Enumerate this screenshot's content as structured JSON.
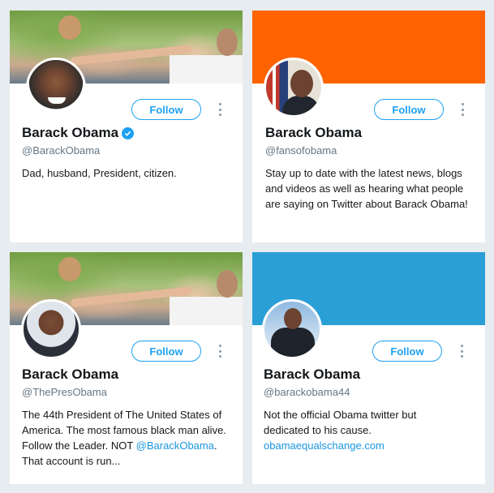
{
  "cards": [
    {
      "name": "Barack Obama",
      "handle": "@BarackObama",
      "follow_label": "Follow",
      "bio": "Dad, husband, President, citizen.",
      "banner": "photo",
      "verified": true
    },
    {
      "name": "Barack Obama",
      "handle": "@fansofobama",
      "follow_label": "Follow",
      "bio": "Stay up to date with the latest news, blogs and videos as well as hearing what people are saying on Twitter about Barack Obama!",
      "banner_color": "#ff6300"
    },
    {
      "name": "Barack Obama",
      "handle": "@ThePresObama",
      "follow_label": "Follow",
      "bio_text": "The 44th President of The United States of America. The most famous black man alive. Follow the Leader. NOT ",
      "bio_link": "@BarackObama",
      "bio_tail": ". That account is run...",
      "banner": "photo"
    },
    {
      "name": "Barack Obama",
      "handle": "@barackobama44",
      "follow_label": "Follow",
      "bio": "Not the official Obama twitter but dedicated to his cause.",
      "link": "obamaequalschange.com",
      "banner_color": "#2a9fd6"
    }
  ],
  "icons": {
    "verified": "verified-badge-icon",
    "more": "more-options-icon"
  },
  "colors": {
    "accent": "#1da1f2",
    "link": "#1b95e0",
    "background": "#e6ecf0"
  }
}
